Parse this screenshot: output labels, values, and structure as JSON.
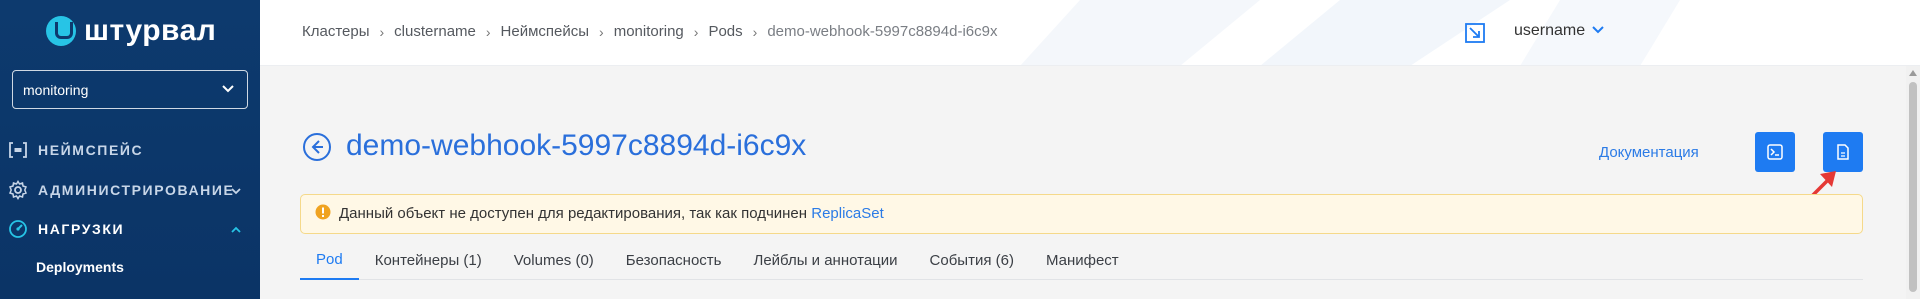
{
  "sidebar": {
    "logo_text": "штурвал",
    "namespace_select": {
      "value": "monitoring"
    },
    "items": [
      {
        "label": "НЕЙМСПЕЙС",
        "icon": "namespace-icon"
      },
      {
        "label": "АДМИНИСТРИРОВАНИЕ",
        "icon": "gear-icon",
        "caret": "chevron-down-icon"
      },
      {
        "label": "НАГРУЗКИ",
        "icon": "gauge-icon",
        "caret": "chevron-up-icon"
      }
    ],
    "sub_items": [
      {
        "label": "Deployments"
      }
    ]
  },
  "header": {
    "breadcrumb": [
      "Кластеры",
      "clustername",
      "Неймспейсы",
      "monitoring",
      "Pods",
      "demo-webhook-5997c8894d-i6c9x"
    ],
    "username": "username"
  },
  "page": {
    "title": "demo-webhook-5997c8894d-i6c9x",
    "doc_link": "Документация",
    "alert": {
      "text": "Данный объект не доступен для редактирования, так как подчинен ",
      "link": "ReplicaSet"
    },
    "tabs": [
      "Pod",
      "Контейнеры (1)",
      "Volumes (0)",
      "Безопасность",
      "Лейблы и аннотации",
      "События (6)",
      "Манифест"
    ],
    "active_tab": "Pod"
  },
  "colors": {
    "sidebar_bg": "#0d3a6e",
    "accent": "#1e7bf2",
    "alert_bg": "#fff8e6",
    "alert_icon": "#f0a320",
    "annotation_arrow": "#e53935"
  }
}
